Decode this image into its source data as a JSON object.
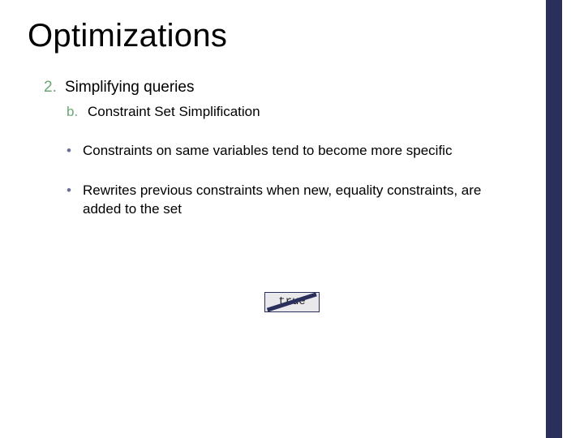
{
  "title": "Optimizations",
  "list": {
    "l2": {
      "marker": "2.",
      "text": "Simplifying queries"
    },
    "l3": {
      "marker": "b.",
      "text": "Constraint Set Simplification"
    }
  },
  "bullets": [
    "Constraints on same variables tend to become more specific",
    "Rewrites previous constraints when new, equality constraints, are added to the set"
  ],
  "bullet_marker": "•",
  "truebox": {
    "label": "true"
  },
  "colors": {
    "accent_bar": "#2a2f5b",
    "list_marker": "#6aa774",
    "bullet_marker": "#6a6f93"
  }
}
